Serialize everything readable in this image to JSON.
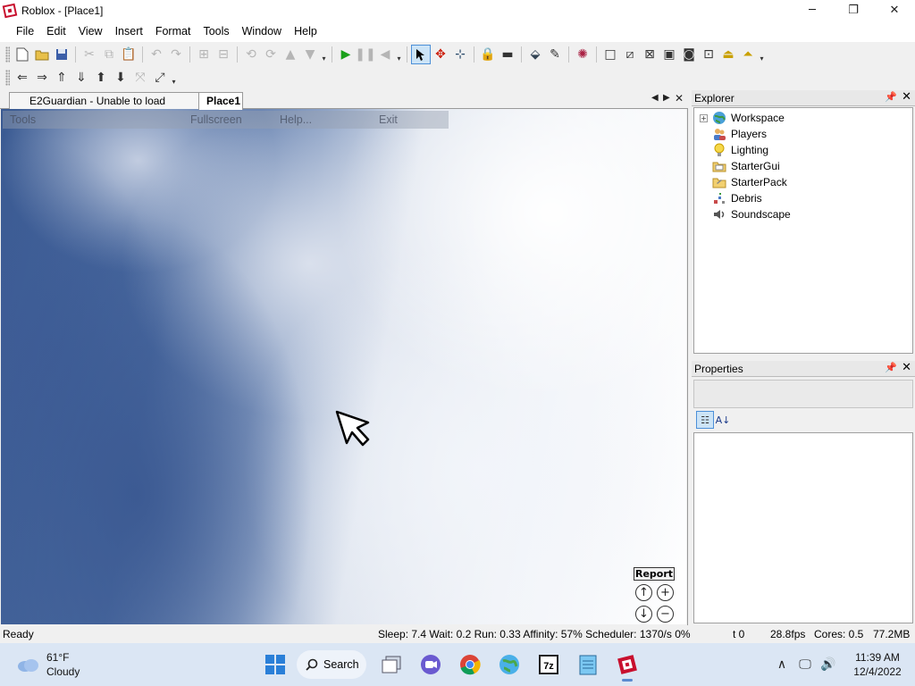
{
  "window": {
    "title": "Roblox - [Place1]",
    "minimize": "─",
    "maximize": "❐",
    "close": "✕"
  },
  "menu": [
    "File",
    "Edit",
    "View",
    "Insert",
    "Format",
    "Tools",
    "Window",
    "Help"
  ],
  "tabs": {
    "tab1": "E2Guardian - Unable to load website",
    "tab2": "Place1",
    "prev": "◀",
    "next": "▶",
    "close": "✕"
  },
  "game_menu": {
    "tools": "Tools",
    "fullscreen": "Fullscreen",
    "help": "Help...",
    "exit": "Exit"
  },
  "viewport": {
    "report": "Report"
  },
  "explorer": {
    "title": "Explorer",
    "items": [
      {
        "label": "Workspace",
        "icon": "globe-icon",
        "expandable": true
      },
      {
        "label": "Players",
        "icon": "players-icon",
        "expandable": false
      },
      {
        "label": "Lighting",
        "icon": "lightbulb-icon",
        "expandable": false
      },
      {
        "label": "StarterGui",
        "icon": "folder-icon",
        "expandable": false
      },
      {
        "label": "StarterPack",
        "icon": "backpack-icon",
        "expandable": false
      },
      {
        "label": "Debris",
        "icon": "debris-icon",
        "expandable": false
      },
      {
        "label": "Soundscape",
        "icon": "speaker-icon",
        "expandable": false
      }
    ]
  },
  "properties": {
    "title": "Properties"
  },
  "status": {
    "ready": "Ready",
    "metrics": "Sleep: 7.4 Wait: 0.2 Run: 0.33 Affinity: 57% Scheduler: 1370/s 0%",
    "t": "t 0",
    "fps": "28.8fps",
    "cores": "Cores: 0.5",
    "mem": "77.2MB"
  },
  "taskbar": {
    "temp": "61°F",
    "weather": "Cloudy",
    "search": "Search",
    "time": "11:39 AM",
    "date": "12/4/2022"
  },
  "colors": {
    "accent": "#0078d7",
    "roblox_red": "#c8102e"
  }
}
